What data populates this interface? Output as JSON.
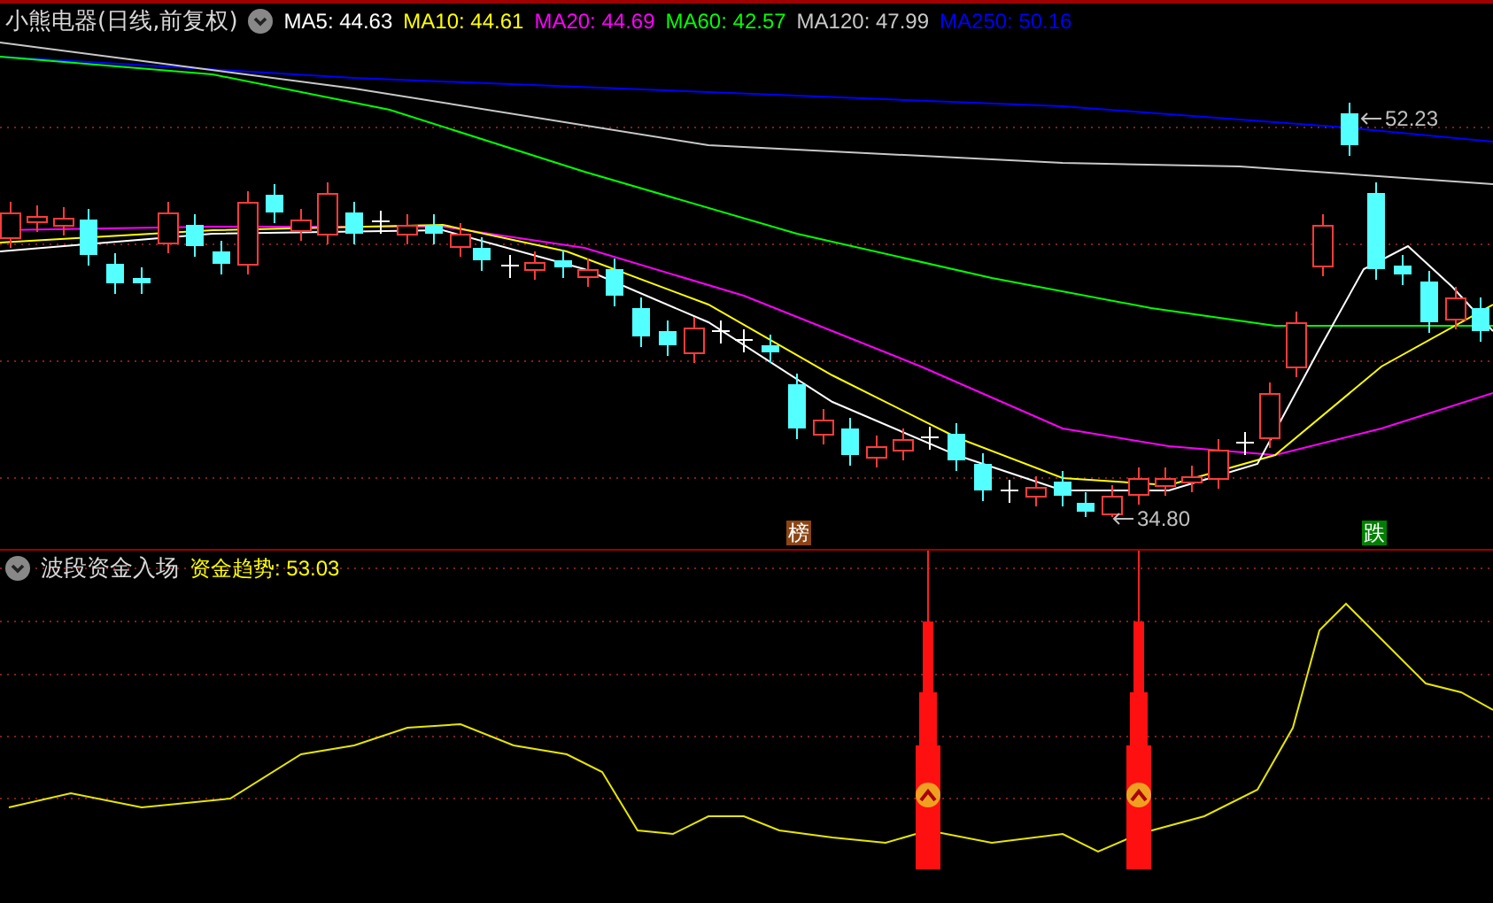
{
  "header": {
    "title": "小熊电器(日线,前复权)",
    "indicators": [
      {
        "label": "MA5: 44.63",
        "color": "#ffffff"
      },
      {
        "label": "MA10: 44.61",
        "color": "#ffff00"
      },
      {
        "label": "MA20: 44.69",
        "color": "#ff00ff"
      },
      {
        "label": "MA60: 42.57",
        "color": "#00ff00"
      },
      {
        "label": "MA120: 47.99",
        "color": "#c8c8c8"
      },
      {
        "label": "MA250: 50.16",
        "color": "#0000ff"
      }
    ]
  },
  "main_chart": {
    "high_label": "52.23",
    "low_label": "34.80",
    "markers": [
      {
        "text": "榜",
        "color": "#8b4513"
      },
      {
        "text": "跌",
        "color": "#008000"
      }
    ]
  },
  "sub_panel": {
    "title": "波段资金入场",
    "indicator": "资金趋势: 53.03"
  }
}
